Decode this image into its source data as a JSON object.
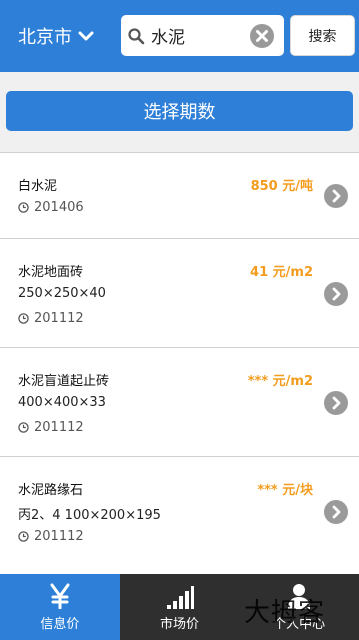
{
  "header": {
    "city": "北京市",
    "search_value": "水泥",
    "search_button": "搜索"
  },
  "period_button": "选择期数",
  "items": [
    {
      "name": "白水泥",
      "spec": "",
      "date": "201406",
      "price": "850 元/吨"
    },
    {
      "name": "水泥地面砖",
      "spec": "250×250×40",
      "date": "201112",
      "price": "41 元/m2"
    },
    {
      "name": "水泥盲道起止砖",
      "spec": "400×400×33",
      "date": "201112",
      "price": "*** 元/m2"
    },
    {
      "name": "水泥路缘石",
      "spec": "丙2、4 100×200×195",
      "date": "201112",
      "price": "*** 元/块"
    }
  ],
  "tabs": [
    {
      "label": "信息价",
      "icon": "yen-icon",
      "active": true
    },
    {
      "label": "市场价",
      "icon": "bar-chart-icon",
      "active": false
    },
    {
      "label": "个人中心",
      "icon": "user-icon",
      "active": false
    }
  ],
  "watermark": "大拇客",
  "colors": {
    "primary": "#2d7fd8",
    "price": "#f39c1e",
    "tabbar": "#2f2f2f"
  }
}
